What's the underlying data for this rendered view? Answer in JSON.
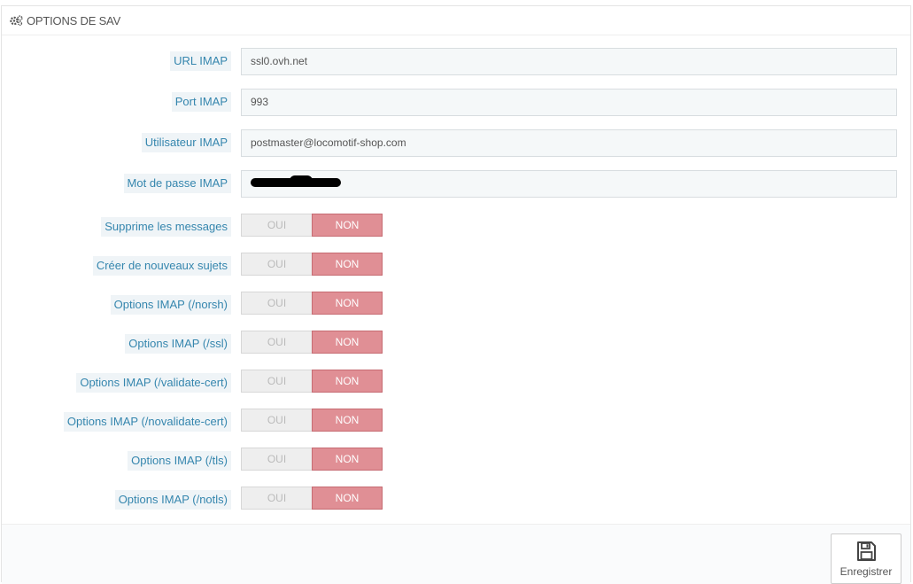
{
  "panel": {
    "title": "OPTIONS DE SAV",
    "title_icon": "gears-icon"
  },
  "fields": [
    {
      "label": "URL IMAP",
      "value": "ssl0.ovh.net"
    },
    {
      "label": "Port IMAP",
      "value": "993"
    },
    {
      "label": "Utilisateur IMAP",
      "value": "postmaster@locomotif-shop.com"
    },
    {
      "label": "Mot de passe IMAP",
      "value": ""
    }
  ],
  "toggles": [
    {
      "label": "Supprime les messages",
      "yes": "OUI",
      "no": "NON",
      "selected": "NON"
    },
    {
      "label": "Créer de nouveaux sujets",
      "yes": "OUI",
      "no": "NON",
      "selected": "NON"
    },
    {
      "label": "Options IMAP (/norsh)",
      "yes": "OUI",
      "no": "NON",
      "selected": "NON"
    },
    {
      "label": "Options IMAP (/ssl)",
      "yes": "OUI",
      "no": "NON",
      "selected": "NON"
    },
    {
      "label": "Options IMAP (/validate-cert)",
      "yes": "OUI",
      "no": "NON",
      "selected": "NON"
    },
    {
      "label": "Options IMAP (/novalidate-cert)",
      "yes": "OUI",
      "no": "NON",
      "selected": "NON"
    },
    {
      "label": "Options IMAP (/tls)",
      "yes": "OUI",
      "no": "NON",
      "selected": "NON"
    },
    {
      "label": "Options IMAP (/notls)",
      "yes": "OUI",
      "no": "NON",
      "selected": "NON"
    }
  ],
  "footer": {
    "save_label": "Enregistrer",
    "save_icon": "floppy-disk-icon"
  },
  "colors": {
    "label_bg": "#eff4f7",
    "label_text": "#3586ae",
    "toggle_active": "#e08f95"
  }
}
